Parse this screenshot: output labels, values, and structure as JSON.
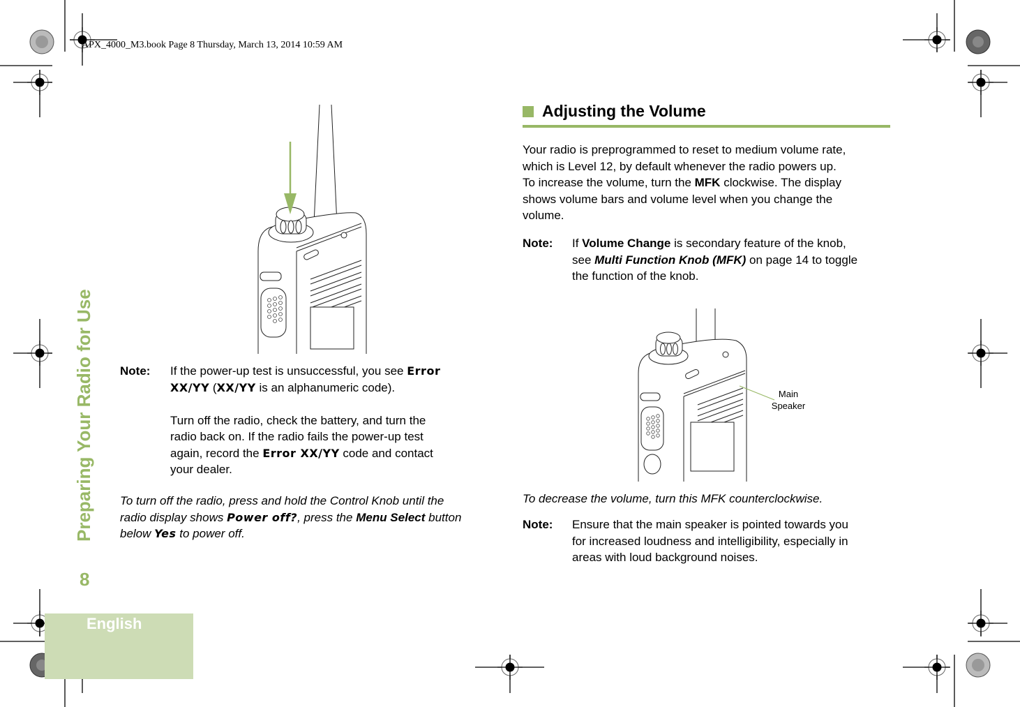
{
  "header": {
    "book_info": "APX_4000_M3.book  Page 8  Thursday, March 13, 2014  10:59 AM"
  },
  "sidebar": {
    "chapter_title": "Preparing Your Radio for Use",
    "page_number": "8",
    "language_tab": "English"
  },
  "left_column": {
    "note1": {
      "label": "Note:",
      "line1_pre": "If the power-up test is unsuccessful, you see ",
      "error_code_a": "Error",
      "error_code_b": "XX/YY",
      "open_paren": " (",
      "code_ref": "XX/YY",
      "line2_post": " is an alphanumeric code).",
      "para2_line1": "Turn off the radio, check the battery, and turn the",
      "para2_line2": "radio back on. If the radio fails the power-up test",
      "para2_line3_pre": "again, record the ",
      "para2_error": "Error XX/YY",
      "para2_line3_post": " code and contact",
      "para2_line4": "your dealer."
    },
    "power_off_instruction": {
      "line1": "To turn off the radio, press and hold the Control Knob until the",
      "line2_pre": "radio display shows ",
      "display_text": "Power off?",
      "line2_mid": ", press the ",
      "button_name": "Menu Select",
      "line2_post": " button",
      "line3_pre": "below ",
      "softkey": "Yes",
      "line3_post": " to power off."
    }
  },
  "right_column": {
    "section_title": "Adjusting the Volume",
    "intro": {
      "line1": "Your radio is preprogrammed to reset to medium volume rate,",
      "line2": "which is Level 12, by default whenever the radio powers up.",
      "line3_pre": "To increase the volume, turn the ",
      "line3_bold": "MFK",
      "line3_post": " clockwise. The display",
      "line4": "shows volume bars and volume level when you change the",
      "line5": "volume."
    },
    "note2": {
      "label": "Note:",
      "line1_pre": "If ",
      "line1_bold": "Volume Change",
      "line1_post": " is secondary feature of the knob,",
      "line2_pre": "see ",
      "line2_link": "Multi Function Knob (MFK)",
      "line2_post": " on page 14 to toggle",
      "line3": "the function of the knob."
    },
    "figure_callout": {
      "line1": "Main",
      "line2": "Speaker"
    },
    "decrease_instruction": "To decrease the volume, turn this MFK counterclockwise.",
    "note3": {
      "label": "Note:",
      "line1": "Ensure that the main speaker is pointed towards you",
      "line2": "for increased loudness and intelligibility, especially in",
      "line3": "areas with loud background noises."
    }
  },
  "colors": {
    "accent_green": "#98b866",
    "tab_green": "#cddcb5"
  }
}
